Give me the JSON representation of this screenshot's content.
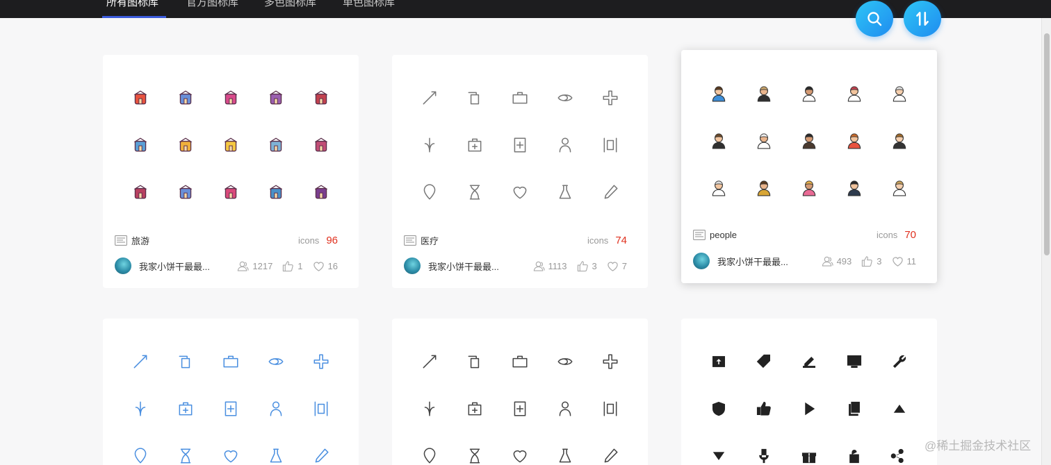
{
  "nav": {
    "tabs": [
      {
        "label": "所有图标库",
        "active": true
      },
      {
        "label": "官方图标库",
        "active": false
      },
      {
        "label": "多色图标库",
        "active": false
      },
      {
        "label": "单色图标库",
        "active": false
      }
    ]
  },
  "actions": {
    "search_icon": "search-icon",
    "sort_icon": "sort-icon"
  },
  "cards": [
    {
      "name": "旅游",
      "icons_label": "icons",
      "count": "96",
      "author": "我家小饼干最最...",
      "views": "1217",
      "likes": "1",
      "favorites": "16",
      "style": "multicolor",
      "icons": [
        "sunbed-icon",
        "airplane-icon",
        "stroller-icon",
        "tent-icon",
        "barn-icon",
        "hotel-icon",
        "beach-icon",
        "bag-icon",
        "baby-icon",
        "camera-icon",
        "pillar-icon",
        "anchor-icon",
        "bikini-icon",
        "bicycle-icon",
        "wine-icon"
      ]
    },
    {
      "name": "医疗",
      "icons_label": "icons",
      "count": "74",
      "author": "我家小饼干最最...",
      "views": "1113",
      "likes": "3",
      "favorites": "7",
      "style": "outline-gray",
      "icons": [
        "scalpel-icon",
        "syringe-icon",
        "ambulance-icon",
        "eye-icon",
        "medical-star-icon",
        "hair-icon",
        "first-aid-kit-icon",
        "hospital-sign-icon",
        "patient-icon",
        "hospital-board-icon",
        "location-pin-icon",
        "hourglass-icon",
        "heart-icon",
        "flask-icon",
        "dropper-icon"
      ]
    },
    {
      "name": "people",
      "icons_label": "icons",
      "count": "70",
      "author": "我家小饼干最最...",
      "views": "493",
      "likes": "3",
      "favorites": "11",
      "style": "people",
      "icons": [
        "man-blue-icon",
        "man-suit-icon",
        "bearded-man-icon",
        "woman-hijab-icon",
        "old-man-icon",
        "woman-suit-icon",
        "chef-icon",
        "man-beard-icon",
        "woman-red-icon",
        "man-yellow-icon",
        "doctor-icon",
        "police-icon",
        "girl-pink-icon",
        "graduate-icon",
        "man-glasses-icon"
      ]
    },
    {
      "style": "outline-blue",
      "icons": [
        "send-icon",
        "copy-icon",
        "org-chart-icon",
        "pie-chart-icon",
        "shopping-bag-icon",
        "mail-icon",
        "layers-icon",
        "map-pin-icon",
        "speaker-icon",
        "thumbs-up-icon",
        "database-icon",
        "diamond-icon",
        "heart-shield-icon",
        "line-chart-icon",
        "qr-code-icon"
      ]
    },
    {
      "style": "outline-dark",
      "icons": [
        "save-icon",
        "tag-icon",
        "edit-note-icon",
        "tools-icon",
        "like-icon",
        "add-circle-icon",
        "taxi-icon",
        "location-icon",
        "share-arrow-icon",
        "alarm-clock-icon",
        "compass-icon",
        "fingerprint-icon",
        "briefcase-icon",
        "receipt-icon",
        "siren-icon"
      ]
    },
    {
      "style": "solid-black",
      "icons": [
        "upload-box-icon",
        "tag-solid-icon",
        "pen-icon",
        "monitor-icon",
        "wrench-icon",
        "shield-icon",
        "thumbs-up-solid-icon",
        "play-icon",
        "copy-solid-icon",
        "triangle-up-icon",
        "triangle-down-icon",
        "microphone-icon",
        "gift-icon",
        "unlock-icon",
        "share-icon"
      ]
    }
  ],
  "watermark": "@稀土掘金技术社区",
  "colors": {
    "accent": "#1f8cf0",
    "count": "#e0301e",
    "blue_icon": "#4a8fe0",
    "topbar": "#1d1d1f"
  }
}
